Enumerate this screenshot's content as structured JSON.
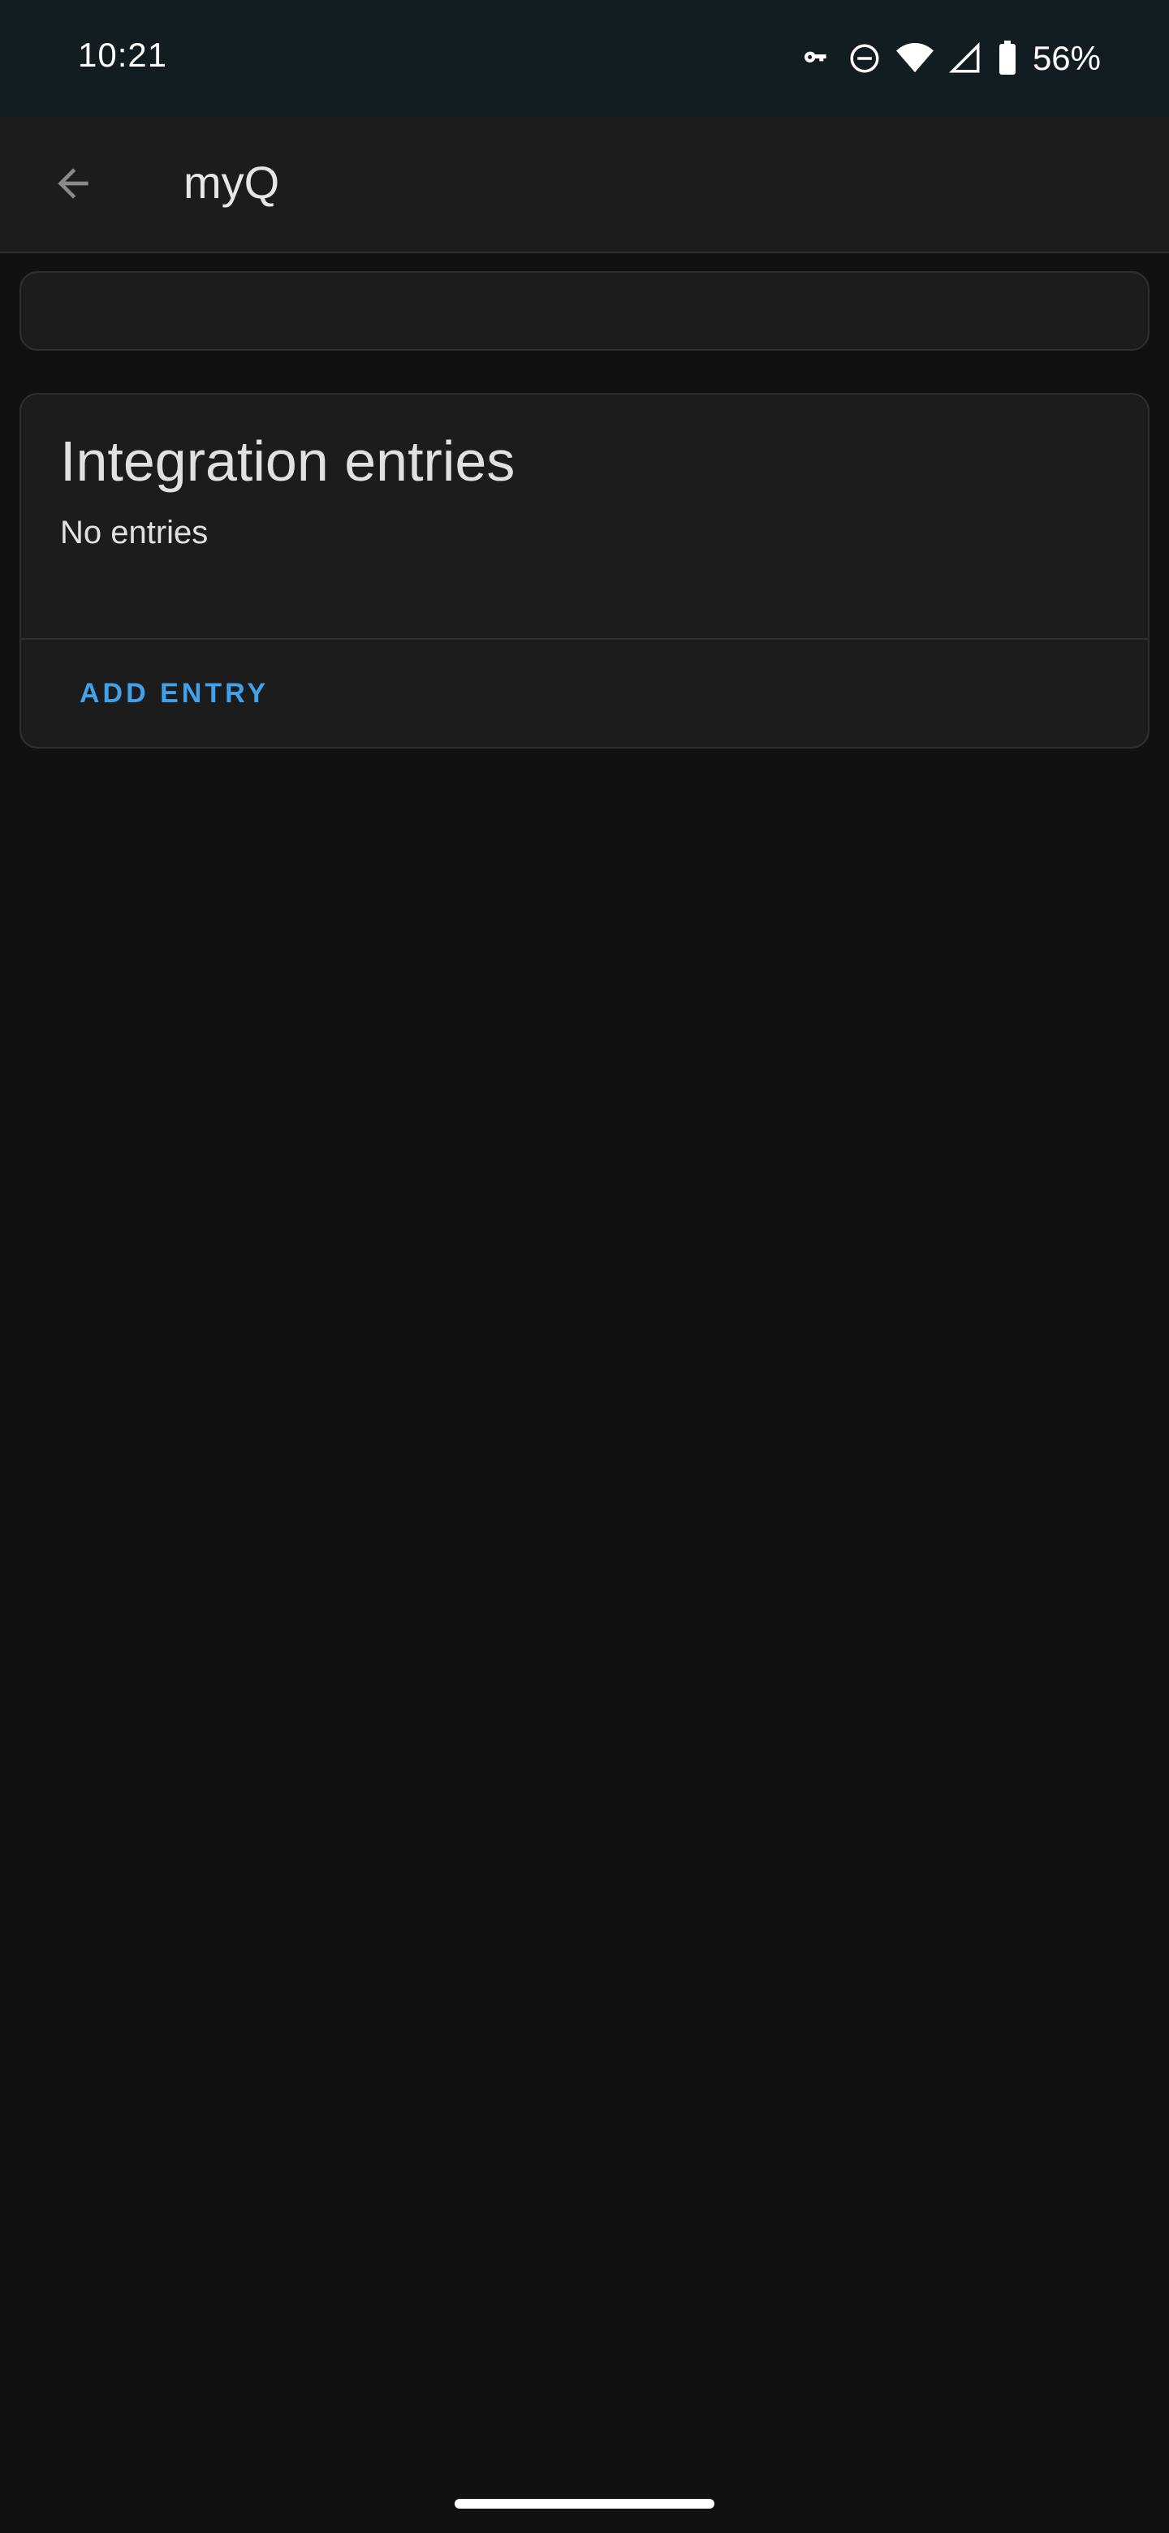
{
  "status_bar": {
    "time": "10:21",
    "battery_percent": "56%",
    "icons": [
      "vpn-key-icon",
      "do-not-disturb-icon",
      "wifi-icon",
      "cell-signal-icon",
      "battery-icon"
    ]
  },
  "app_bar": {
    "title": "myQ",
    "back_icon": "arrow-back-icon"
  },
  "integration_entries": {
    "heading": "Integration entries",
    "empty_text": "No entries",
    "add_button_label": "ADD ENTRY"
  },
  "colors": {
    "background": "#111111",
    "status_bar": "#121d21",
    "surface": "#1c1c1c",
    "accent": "#41a1ea"
  }
}
